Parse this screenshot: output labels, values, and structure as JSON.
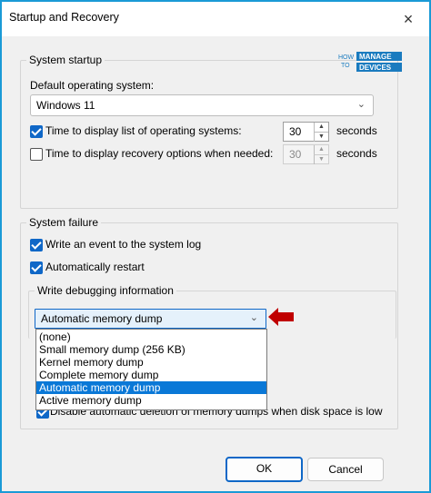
{
  "window": {
    "title": "Startup and Recovery",
    "close_icon": "×"
  },
  "logo": {
    "line1": "HOW",
    "line2": "TO",
    "manage": "MANAGE",
    "devices": "DEVICES"
  },
  "system_startup": {
    "legend": "System startup",
    "default_os_label": "Default operating system:",
    "default_os_value": "Windows 11",
    "display_list_label": "Time to display list of operating systems:",
    "display_list_checked": true,
    "display_list_value": "30",
    "display_recovery_label": "Time to display recovery options when needed:",
    "display_recovery_checked": false,
    "display_recovery_value": "30",
    "seconds_label": "seconds"
  },
  "system_failure": {
    "legend": "System failure",
    "write_event_label": "Write an event to the system log",
    "write_event_checked": true,
    "auto_restart_label": "Automatically restart",
    "auto_restart_checked": true,
    "debug_legend": "Write debugging information",
    "dump_selected": "Automatic memory dump",
    "dump_options": [
      "(none)",
      "Small memory dump (256 KB)",
      "Kernel memory dump",
      "Complete memory dump",
      "Automatic memory dump",
      "Active memory dump"
    ],
    "dump_selected_index": 4,
    "disable_delete_label": "Disable automatic deletion of memory dumps when disk space is low",
    "disable_delete_checked": true
  },
  "buttons": {
    "ok": "OK",
    "cancel": "Cancel"
  },
  "colors": {
    "accent": "#0f67c7",
    "annotation": "#e00000",
    "frame": "#1a9ad6"
  }
}
